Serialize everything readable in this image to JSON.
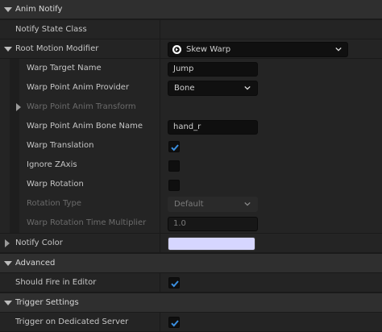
{
  "section_anim_notify": {
    "title": "Anim Notify"
  },
  "notify_state_class": {
    "label": "Notify State Class"
  },
  "root_motion_modifier": {
    "label": "Root Motion Modifier",
    "value": "Skew Warp"
  },
  "warp_target_name": {
    "label": "Warp Target Name",
    "value": "Jump"
  },
  "warp_point_anim_provider": {
    "label": "Warp Point Anim Provider",
    "value": "Bone"
  },
  "warp_point_anim_transform": {
    "label": "Warp Point Anim Transform"
  },
  "warp_point_anim_bone_name": {
    "label": "Warp Point Anim Bone Name",
    "value": "hand_r"
  },
  "warp_translation": {
    "label": "Warp Translation",
    "checked": true
  },
  "ignore_z_axis": {
    "label": "Ignore ZAxis",
    "checked": false
  },
  "warp_rotation": {
    "label": "Warp Rotation",
    "checked": false
  },
  "rotation_type": {
    "label": "Rotation Type",
    "value": "Default"
  },
  "warp_rotation_time_multiplier": {
    "label": "Warp Rotation Time Multiplier",
    "value": "1.0"
  },
  "notify_color": {
    "label": "Notify Color",
    "color": "#d6d6ff"
  },
  "section_advanced": {
    "title": "Advanced"
  },
  "should_fire_in_editor": {
    "label": "Should Fire in Editor",
    "checked": true
  },
  "section_trigger_settings": {
    "title": "Trigger Settings"
  },
  "trigger_on_dedicated_server": {
    "label": "Trigger on Dedicated Server",
    "checked": true
  },
  "colors": {
    "accent_check": "#3b8fe0",
    "panel_bg": "#1a1a1a",
    "row_bg": "#242424",
    "category_bg": "#2f2f2f"
  }
}
